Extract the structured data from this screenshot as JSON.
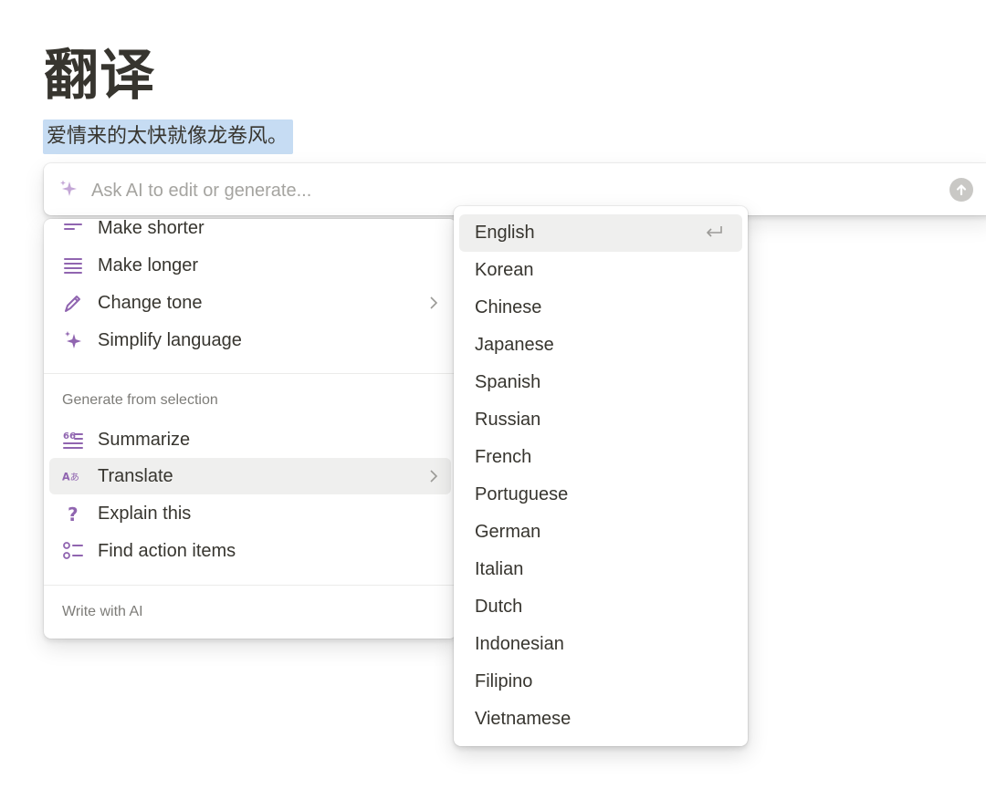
{
  "page": {
    "title": "翻译",
    "selected_text": "爱情来的太快就像龙卷风。"
  },
  "ai_bar": {
    "placeholder": "Ask AI to edit or generate...",
    "value": ""
  },
  "menu": {
    "edit_items": [
      {
        "label": "Make shorter",
        "icon": "short-text-icon"
      },
      {
        "label": "Make longer",
        "icon": "long-text-icon"
      },
      {
        "label": "Change tone",
        "icon": "pen-icon",
        "has_submenu": true
      },
      {
        "label": "Simplify language",
        "icon": "sparkle-icon"
      }
    ],
    "generate_section_label": "Generate from selection",
    "generate_items": [
      {
        "label": "Summarize",
        "icon": "summarize-icon"
      },
      {
        "label": "Translate",
        "icon": "translate-icon",
        "has_submenu": true,
        "active": true
      },
      {
        "label": "Explain this",
        "icon": "question-icon"
      },
      {
        "label": "Find action items",
        "icon": "checklist-icon"
      }
    ],
    "write_section_label": "Write with AI"
  },
  "languages": [
    {
      "label": "English",
      "active": true
    },
    {
      "label": "Korean"
    },
    {
      "label": "Chinese"
    },
    {
      "label": "Japanese"
    },
    {
      "label": "Spanish"
    },
    {
      "label": "Russian"
    },
    {
      "label": "French"
    },
    {
      "label": "Portuguese"
    },
    {
      "label": "German"
    },
    {
      "label": "Italian"
    },
    {
      "label": "Dutch"
    },
    {
      "label": "Indonesian"
    },
    {
      "label": "Filipino"
    },
    {
      "label": "Vietnamese"
    }
  ],
  "colors": {
    "icon_purple": "#9065b0",
    "selection": "#c6dcf3",
    "hover": "#efefee",
    "text": "#37352f",
    "muted": "#7d7c78"
  }
}
